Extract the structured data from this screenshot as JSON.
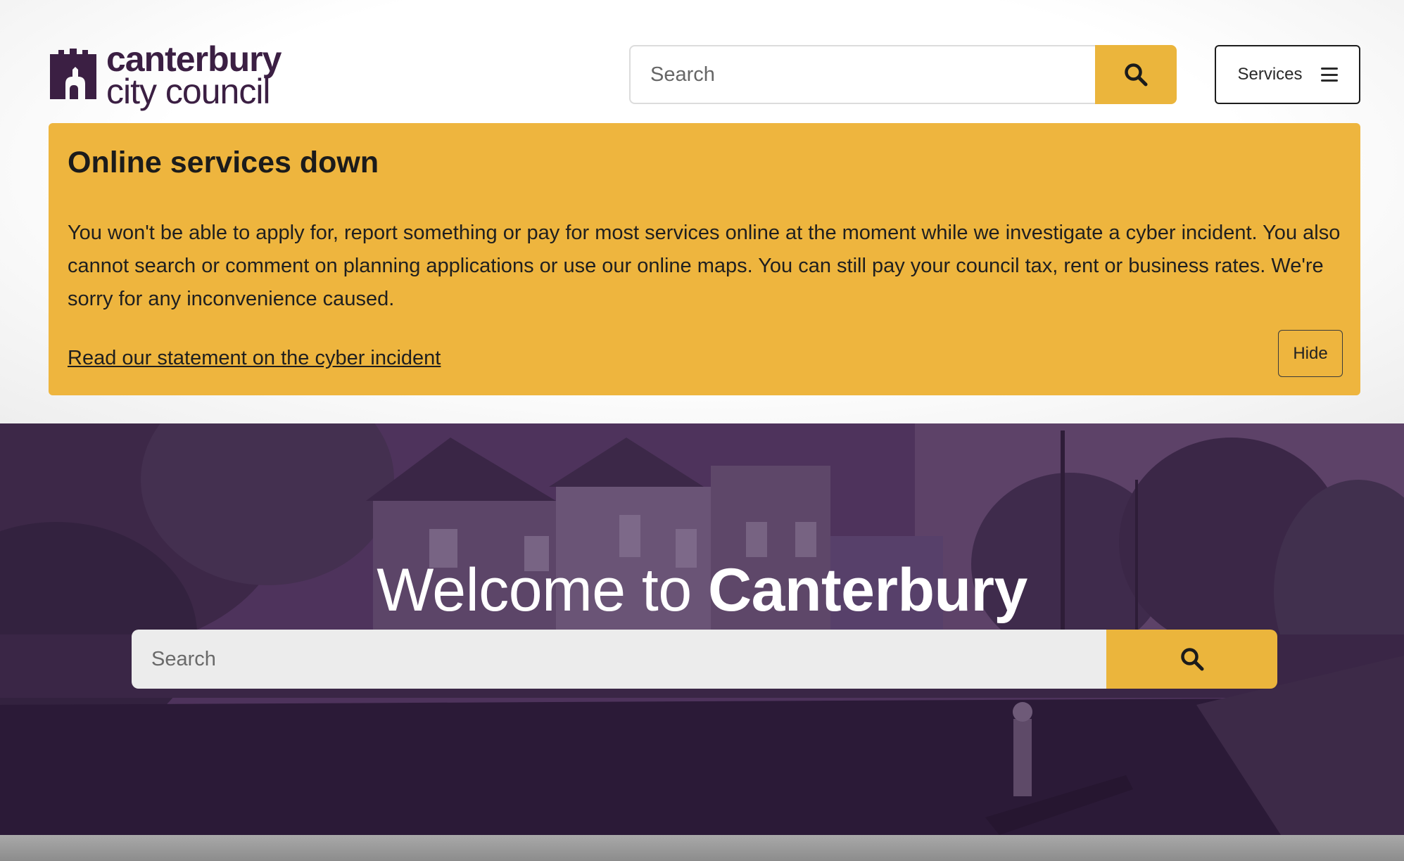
{
  "header": {
    "logo": {
      "line1": "canterbury",
      "line2": "city council"
    },
    "search": {
      "placeholder": "Search"
    },
    "services_label": "Services"
  },
  "alert": {
    "title": "Online services down",
    "body": "You won't be able to apply for, report something or pay for most services online at the moment while we investigate a cyber incident. You also cannot search or comment on planning applications or use our online maps. You can still pay your council tax, rent or business rates. We're sorry for any inconvenience caused.",
    "link_text": "Read our statement on the cyber incident",
    "hide_label": "Hide"
  },
  "hero": {
    "title_prefix": "Welcome to ",
    "title_emphasis": "Canterbury",
    "search": {
      "placeholder": "Search"
    }
  },
  "colors": {
    "brand_purple": "#3b1f43",
    "accent_yellow": "#ebb53c",
    "alert_yellow": "#eeb53e"
  },
  "icons": [
    "search-icon",
    "menu-icon",
    "cathedral-logo-icon"
  ]
}
